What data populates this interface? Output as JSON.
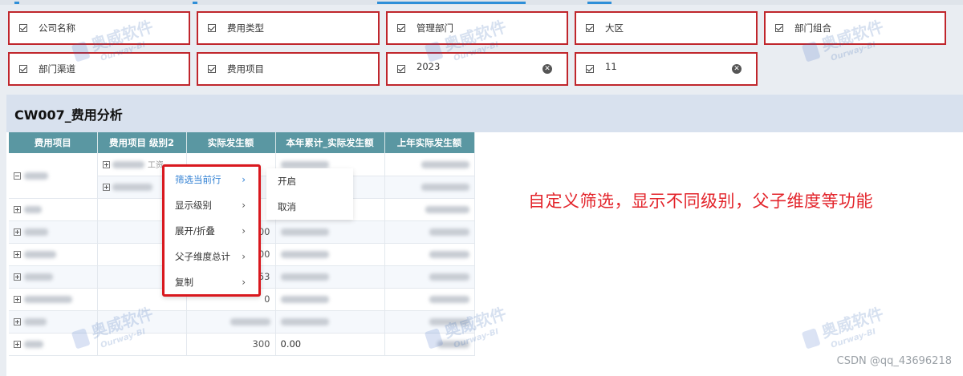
{
  "filters": {
    "row1": [
      {
        "label": "公司名称"
      },
      {
        "label": "费用类型"
      },
      {
        "label": "管理部门"
      },
      {
        "label": "大区"
      },
      {
        "label": "部门组合"
      }
    ],
    "row2": [
      {
        "label": "部门渠道"
      },
      {
        "label": "费用项目"
      },
      {
        "label": "2023",
        "clearable": true
      },
      {
        "label": "11",
        "clearable": true
      }
    ],
    "clear_icon": "x-circle-icon"
  },
  "report": {
    "title": "CW007_费用分析",
    "columns": [
      "费用项目",
      "费用项目 级别2",
      "实际发生额",
      "本年累计_实际发生额",
      "上年实际发生额"
    ],
    "visible_values": {
      "row1_sub1": "工资",
      "row4_actual": "00",
      "row5_actual": "00",
      "row6_actual": "53",
      "row7_actual": "0",
      "row10_actual": "300",
      "row10_ytd": "0.00"
    }
  },
  "context_menu": {
    "items": [
      {
        "label": "筛选当前行",
        "active": true
      },
      {
        "label": "显示级别"
      },
      {
        "label": "展开/折叠"
      },
      {
        "label": "父子维度总计"
      },
      {
        "label": "复制"
      }
    ],
    "submenu": [
      "开启",
      "取消"
    ]
  },
  "annotation": "自定义筛选，显示不同级别，父子维度等功能",
  "credit": "CSDN @qq_43696218",
  "watermark": {
    "cn": "奥威软件",
    "en": "Ourway-BI"
  },
  "colors": {
    "accent": "#2f7fd3",
    "highlight_border": "#d9181e",
    "header": "#5a97a2"
  }
}
